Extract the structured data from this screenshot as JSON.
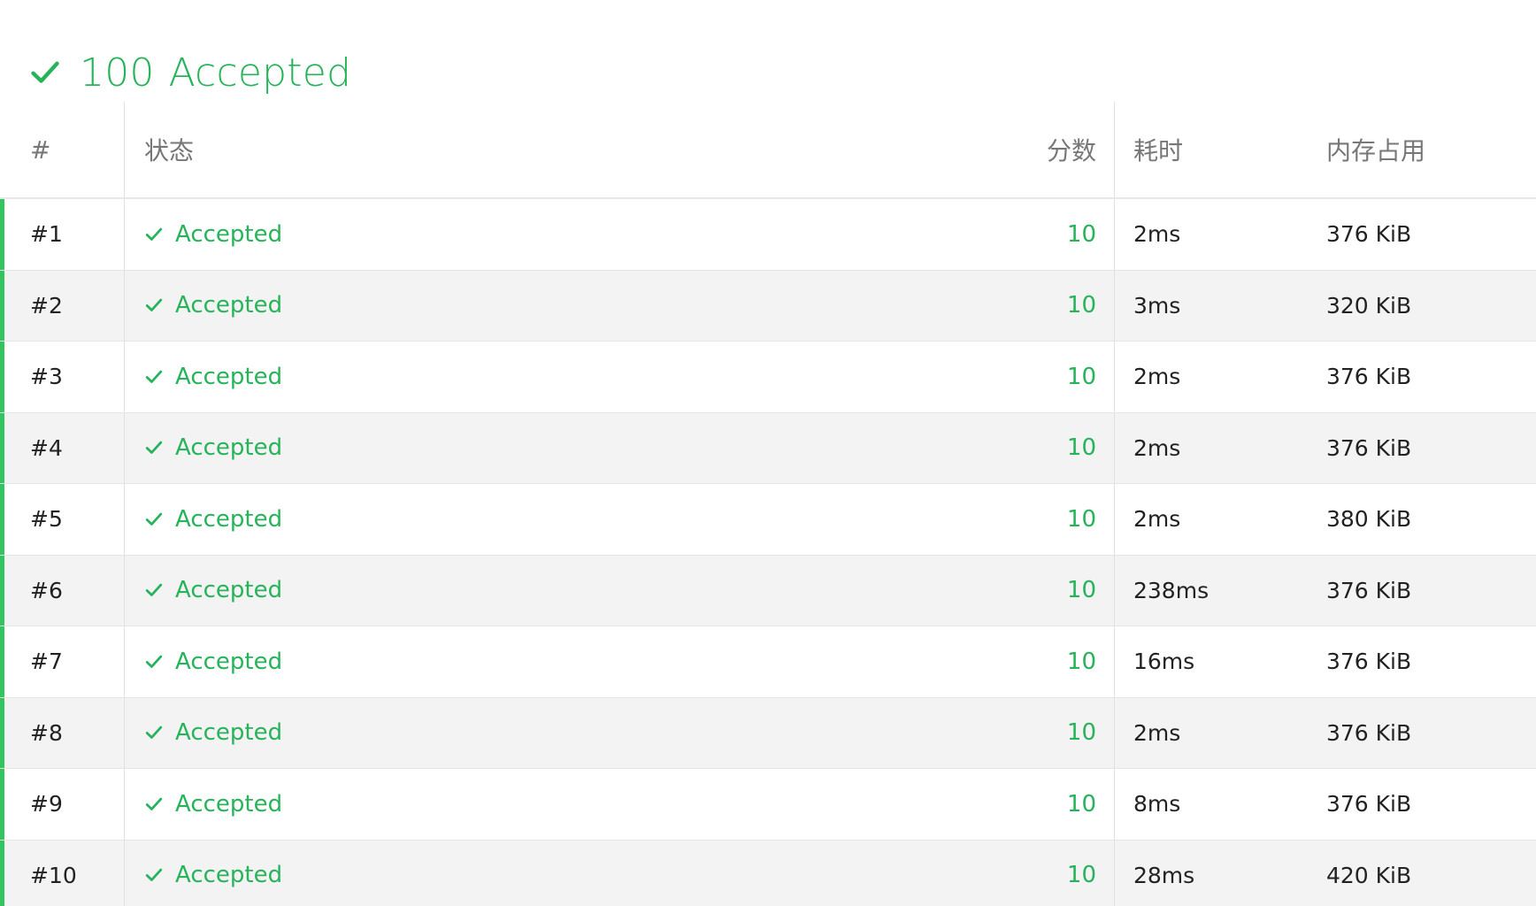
{
  "summary": {
    "score": "100",
    "status": "Accepted",
    "icon": "check-icon",
    "color": "#26b35a"
  },
  "table": {
    "headers": {
      "index": "#",
      "status": "状态",
      "score": "分数",
      "time": "耗时",
      "memory": "内存占用"
    },
    "rows": [
      {
        "index": "#1",
        "status": "Accepted",
        "score": "10",
        "time": "2ms",
        "memory": "376 KiB"
      },
      {
        "index": "#2",
        "status": "Accepted",
        "score": "10",
        "time": "3ms",
        "memory": "320 KiB"
      },
      {
        "index": "#3",
        "status": "Accepted",
        "score": "10",
        "time": "2ms",
        "memory": "376 KiB"
      },
      {
        "index": "#4",
        "status": "Accepted",
        "score": "10",
        "time": "2ms",
        "memory": "376 KiB"
      },
      {
        "index": "#5",
        "status": "Accepted",
        "score": "10",
        "time": "2ms",
        "memory": "380 KiB"
      },
      {
        "index": "#6",
        "status": "Accepted",
        "score": "10",
        "time": "238ms",
        "memory": "376 KiB"
      },
      {
        "index": "#7",
        "status": "Accepted",
        "score": "10",
        "time": "16ms",
        "memory": "376 KiB"
      },
      {
        "index": "#8",
        "status": "Accepted",
        "score": "10",
        "time": "2ms",
        "memory": "376 KiB"
      },
      {
        "index": "#9",
        "status": "Accepted",
        "score": "10",
        "time": "8ms",
        "memory": "376 KiB"
      },
      {
        "index": "#10",
        "status": "Accepted",
        "score": "10",
        "time": "28ms",
        "memory": "420 KiB"
      }
    ]
  }
}
